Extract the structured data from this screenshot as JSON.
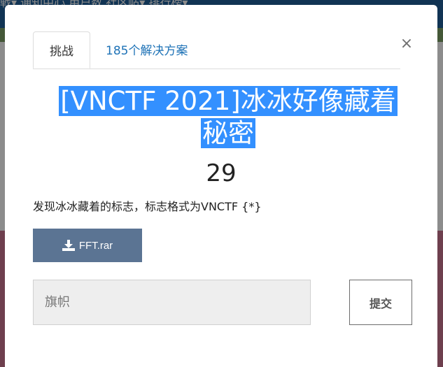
{
  "background_nav": {
    "partial_text": "戦▾   通知中心   用户数   社区帖▾   排行榜▾"
  },
  "modal": {
    "close_symbol": "×",
    "tabs": [
      {
        "label": "挑战",
        "active": true
      },
      {
        "label": "185个解决方案",
        "active": false
      }
    ],
    "challenge": {
      "title_line1": "[VNCTF 2021]冰冰好像藏着",
      "title_line2": "秘密",
      "points": "29",
      "description": "发现冰冰藏着的标志，标志格式为VNCTF {*}",
      "file_label": "FFT.rar",
      "file_icon": "download-icon"
    },
    "flag_input": {
      "placeholder": "旗帜",
      "value": ""
    },
    "submit_label": "提交"
  }
}
